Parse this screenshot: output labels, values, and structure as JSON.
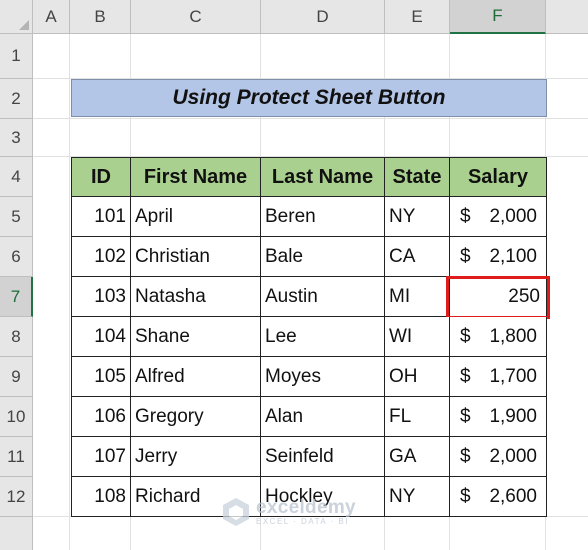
{
  "column_headers": [
    "A",
    "B",
    "C",
    "D",
    "E",
    "F"
  ],
  "row_headers": [
    "1",
    "2",
    "3",
    "4",
    "5",
    "6",
    "7",
    "8",
    "9",
    "10",
    "11",
    "12"
  ],
  "selected_column": "F",
  "selected_row": "7",
  "title": "Using Protect Sheet Button",
  "table": {
    "headers": [
      "ID",
      "First Name",
      "Last Name",
      "State",
      "Salary"
    ],
    "currency_symbol": "$",
    "rows": [
      {
        "id": "101",
        "first": "April",
        "last": "Beren",
        "state": "NY",
        "salary": "2,000"
      },
      {
        "id": "102",
        "first": "Christian",
        "last": "Bale",
        "state": "CA",
        "salary": "2,100"
      },
      {
        "id": "103",
        "first": "Natasha",
        "last": "Austin",
        "state": "MI",
        "salary": "250"
      },
      {
        "id": "104",
        "first": "Shane",
        "last": "Lee",
        "state": "WI",
        "salary": "1,800"
      },
      {
        "id": "105",
        "first": "Alfred",
        "last": "Moyes",
        "state": "OH",
        "salary": "1,700"
      },
      {
        "id": "106",
        "first": "Gregory",
        "last": "Alan",
        "state": "FL",
        "salary": "1,900"
      },
      {
        "id": "107",
        "first": "Jerry",
        "last": "Seinfeld",
        "state": "GA",
        "salary": "2,000"
      },
      {
        "id": "108",
        "first": "Richard",
        "last": "Hockley",
        "state": "NY",
        "salary": "2,600"
      }
    ]
  },
  "watermark": {
    "name": "exceldemy",
    "tagline": "EXCEL · DATA · BI"
  },
  "colors": {
    "header_fill": "#a9d08e",
    "title_fill": "#b4c6e7",
    "highlight_border": "#e01b1b",
    "selection_green": "#217346"
  }
}
